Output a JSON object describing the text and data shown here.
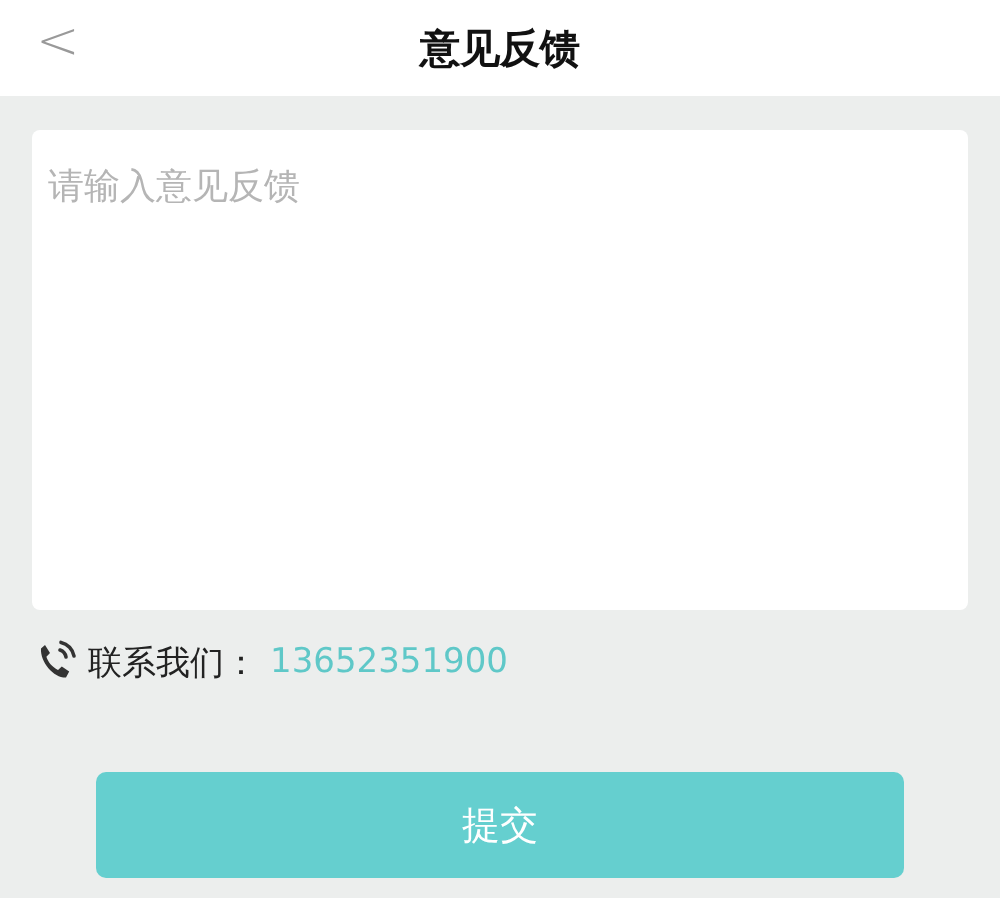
{
  "header": {
    "back": "<",
    "title": "意见反馈"
  },
  "feedback": {
    "placeholder": "请输入意见反馈"
  },
  "contact": {
    "label": "联系我们：",
    "phone": "13652351900"
  },
  "submit": {
    "label": "提交"
  }
}
